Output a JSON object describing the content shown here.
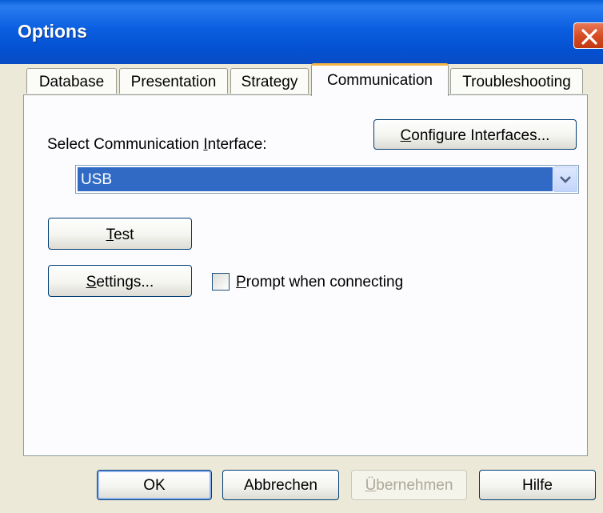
{
  "window": {
    "title": "Options"
  },
  "tabs": [
    {
      "label": "Database"
    },
    {
      "label": "Presentation"
    },
    {
      "label": "Strategy"
    },
    {
      "label": "Communication"
    },
    {
      "label": "Troubleshooting"
    }
  ],
  "communication": {
    "interface_label_pre": "Select Communication ",
    "interface_label_key": "I",
    "interface_label_post": "nterface:",
    "configure_key": "C",
    "configure_rest": "onfigure Interfaces...",
    "selected_interface": "USB",
    "test_key": "T",
    "test_rest": "est",
    "settings_key": "S",
    "settings_rest": "ettings...",
    "prompt_key": "P",
    "prompt_rest": "rompt when connecting",
    "prompt_checked": false
  },
  "footer": {
    "ok": "OK",
    "cancel": "Abbrechen",
    "apply_key": "Ü",
    "apply_rest": "bernehmen",
    "help": "Hilfe"
  }
}
